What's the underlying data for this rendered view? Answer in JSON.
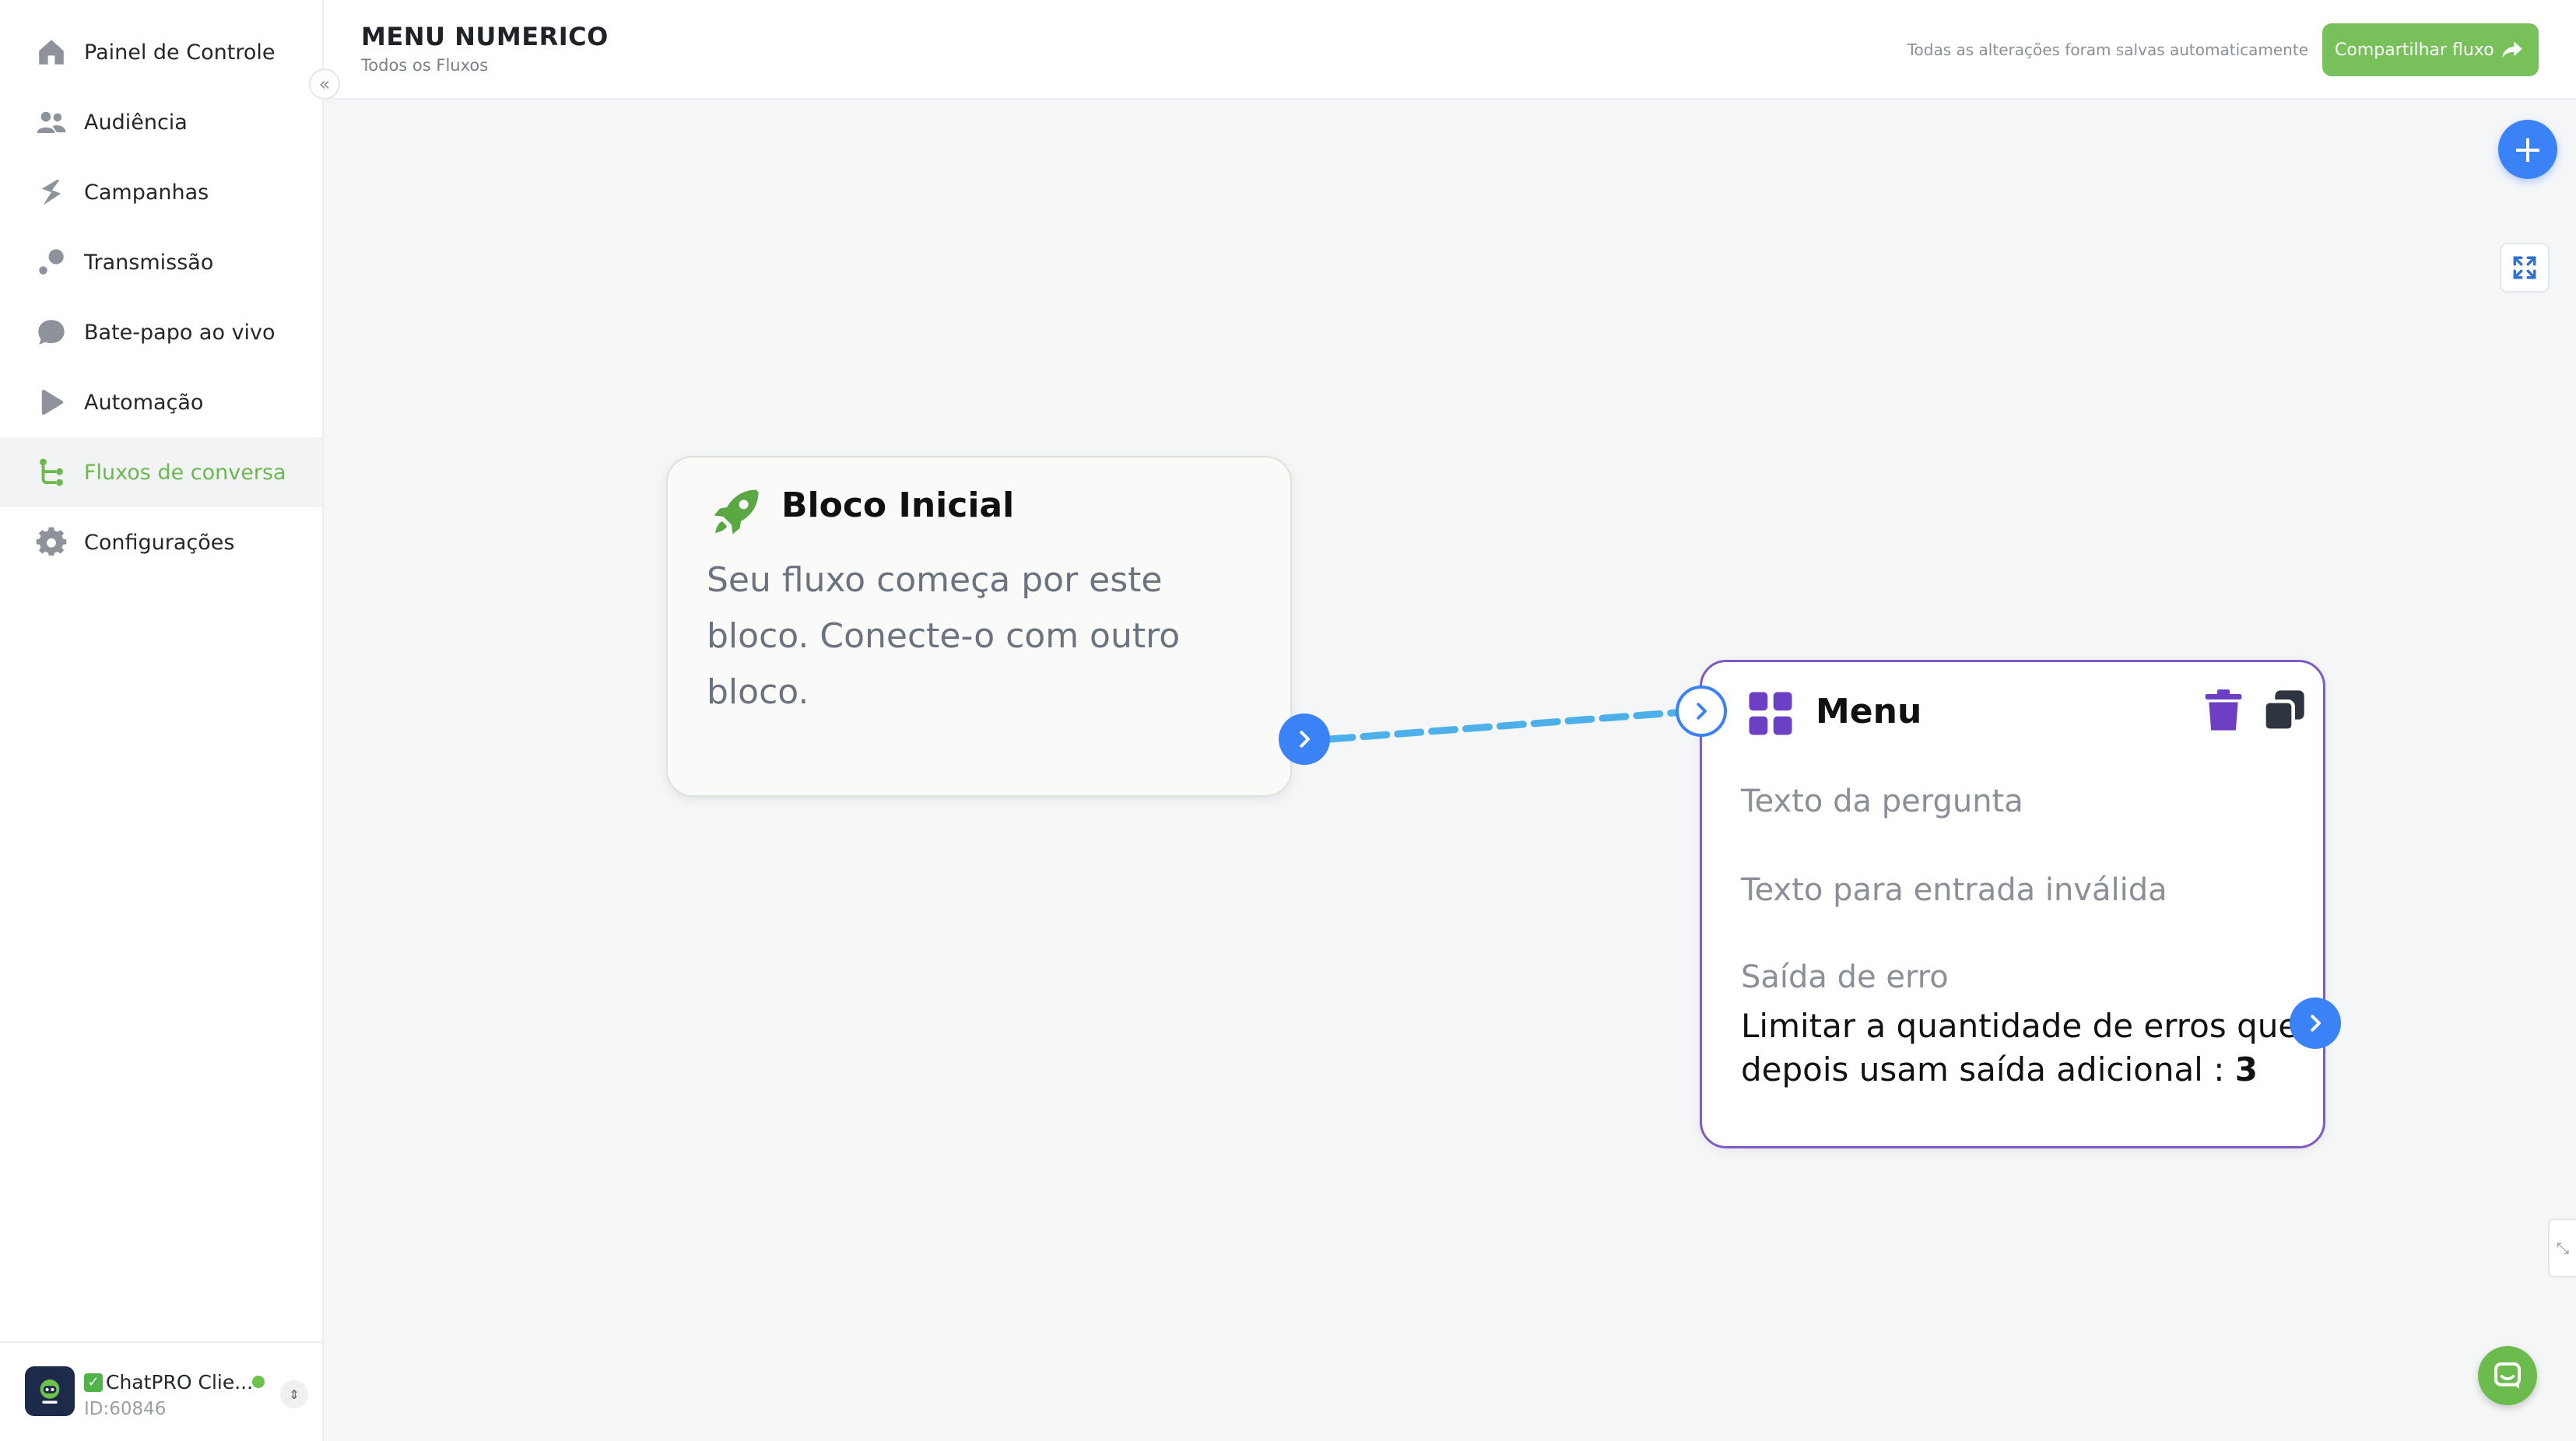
{
  "sidebar": {
    "items": [
      {
        "label": "Painel de Controle",
        "icon": "home-icon"
      },
      {
        "label": "Audiência",
        "icon": "users-icon"
      },
      {
        "label": "Campanhas",
        "icon": "campaign-icon"
      },
      {
        "label": "Transmissão",
        "icon": "broadcast-icon"
      },
      {
        "label": "Bate-papo ao vivo",
        "icon": "chat-icon"
      },
      {
        "label": "Automação",
        "icon": "automation-icon"
      },
      {
        "label": "Fluxos de conversa",
        "icon": "flow-icon"
      },
      {
        "label": "Configurações",
        "icon": "gear-icon"
      }
    ],
    "active_index": 6,
    "collapse_glyph": "«",
    "account": {
      "name": "ChatPRO Clie...",
      "check_glyph": "✓",
      "id": "ID:60846",
      "switch_glyph": "⇕",
      "status_color": "#6cc24a"
    }
  },
  "header": {
    "title": "MENU NUMERICO",
    "breadcrumb": "Todos os Fluxos",
    "autosave": "Todas as alterações foram salvas automaticamente",
    "share_label": "Compartilhar fluxo"
  },
  "canvas": {
    "add_glyph": "+",
    "side_tab_glyph": "⤡",
    "start_block": {
      "title": "Bloco Inicial",
      "description": "Seu fluxo começa por este bloco. Conecte-o com outro bloco."
    },
    "menu_block": {
      "title": "Menu",
      "question_text": "Texto da pergunta",
      "invalid_text": "Texto para entrada inválida",
      "error_exit": "Saída de erro",
      "limit_text": "Limitar a quantidade de erros que depois usam saída adicional : ",
      "limit_value": "3"
    }
  },
  "colors": {
    "accent_green": "#77c05a",
    "active_green": "#6cb84f",
    "port_blue": "#3b82f6",
    "menu_border": "#7c5bc7",
    "connector": "#4eb0e8"
  }
}
